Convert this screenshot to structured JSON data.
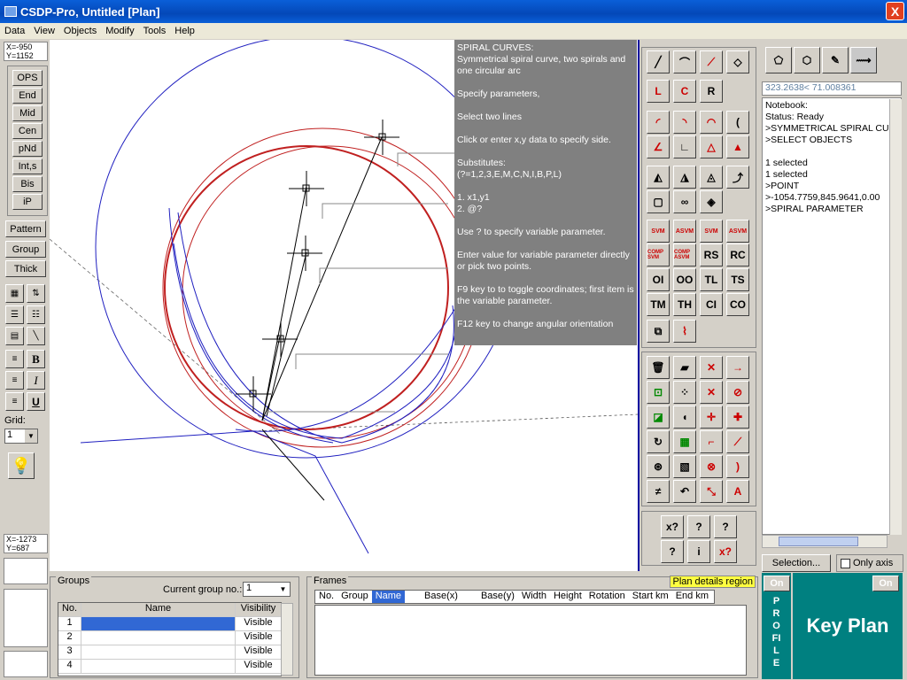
{
  "window": {
    "title": "CSDP-Pro, Untitled [Plan]",
    "close": "X"
  },
  "menu": [
    "Data",
    "View",
    "Objects",
    "Modify",
    "Tools",
    "Help"
  ],
  "coords_top": {
    "x": "X=-950",
    "y": "Y=1152"
  },
  "coords_bottom": {
    "x": "X=-1273",
    "y": "Y=687"
  },
  "snaps": [
    "OPS",
    "End",
    "Mid",
    "Cen",
    "pNd",
    "Int,s",
    "Bis",
    "iP"
  ],
  "left_buttons": [
    "Pattern",
    "Group",
    "Thick"
  ],
  "grid": {
    "label": "Grid:",
    "value": "1"
  },
  "help": {
    "lines": [
      "SPIRAL CURVES:\nSymmetrical spiral curve, two spirals and one circular arc",
      "Specify parameters,",
      "Select two lines",
      "Click or enter x,y data to specify side.",
      "Substitutes:\n(?=1,2,3,E,M,C,N,I,B,P,L)",
      "1. x1,y1\n2. @?",
      "Use ? to specify variable parameter.",
      "Enter value for variable parameter directly or pick two points.",
      "F9 key to to toggle coordinates; first item is the variable parameter.",
      "F12 key to change angular orientation"
    ]
  },
  "tools": {
    "text_buttons": [
      "RS",
      "RC",
      "OI",
      "OO",
      "TL",
      "TS",
      "TM",
      "TH",
      "CI",
      "CO"
    ],
    "letter_buttons": [
      "L",
      "C",
      "R"
    ],
    "help_buttons": [
      "x?",
      "?",
      "?",
      "?",
      "i",
      "x?"
    ]
  },
  "coord_field": "323.2638< 71.008361",
  "notebook": {
    "lines": [
      "Notebook:",
      "Status: Ready",
      ">SYMMETRICAL SPIRAL CU",
      ">SELECT OBJECTS",
      "",
      "1 selected",
      "1 selected",
      ">POINT",
      ">-1054.7759,845.9641,0.00",
      ">SPIRAL PARAMETER"
    ]
  },
  "selection_button": "Selection...",
  "only_axis": "Only axis",
  "groups": {
    "title": "Groups",
    "current_label": "Current group no.:",
    "current_value": "1",
    "headers": [
      "No.",
      "Name",
      "Visibility"
    ],
    "rows": [
      {
        "no": "1",
        "name": "",
        "vis": "Visible"
      },
      {
        "no": "2",
        "name": "",
        "vis": "Visible"
      },
      {
        "no": "3",
        "name": "",
        "vis": "Visible"
      },
      {
        "no": "4",
        "name": "",
        "vis": "Visible"
      }
    ]
  },
  "frames": {
    "title": "Frames",
    "plan_details": "Plan details region",
    "headers": [
      "No.",
      "Group",
      "Name",
      "Base(x)",
      "Base(y)",
      "Width",
      "Height",
      "Rotation",
      "Start km",
      "End km"
    ]
  },
  "profile": {
    "on": "On",
    "label": "PROFILE"
  },
  "keyplan": {
    "on": "On",
    "label": "Key Plan"
  }
}
